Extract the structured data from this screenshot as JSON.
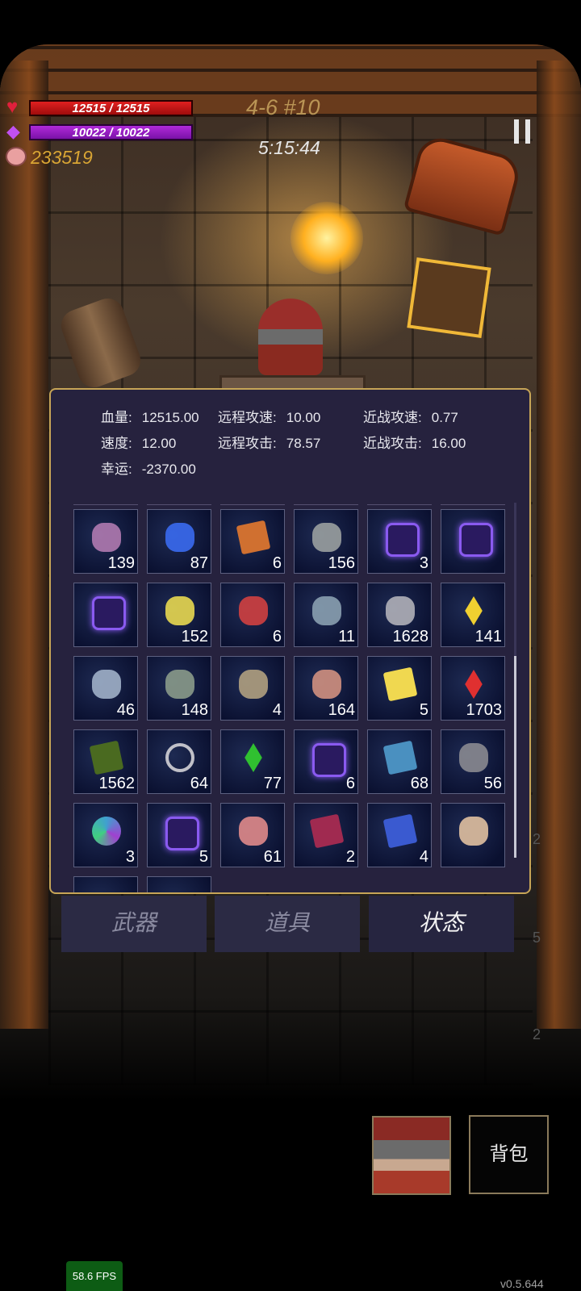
{
  "hud": {
    "hp_text": "12515 / 12515",
    "mp_text": "10022 / 10022",
    "gold": "233519",
    "stage": "4-6 #10",
    "timer": "5:15:44",
    "hp_fraction": 1.0,
    "mp_fraction": 1.0
  },
  "stats": [
    {
      "label": "血量:",
      "value": "12515.00"
    },
    {
      "label": "远程攻速:",
      "value": "10.00"
    },
    {
      "label": "近战攻速:",
      "value": "0.77"
    },
    {
      "label": "速度:",
      "value": "12.00"
    },
    {
      "label": "远程攻击:",
      "value": "78.57"
    },
    {
      "label": "近战攻击:",
      "value": "16.00"
    },
    {
      "label": "幸运:",
      "value": "-2370.00"
    }
  ],
  "inventory": [
    {
      "icon": "boots-icon",
      "count": "139",
      "color": "#b07ab0"
    },
    {
      "icon": "potion-icon",
      "count": "87",
      "color": "#3a6af0"
    },
    {
      "icon": "book-icon",
      "count": "6",
      "color": "#d07030"
    },
    {
      "icon": "flask-icon",
      "count": "156",
      "color": "#9aa0a0"
    },
    {
      "icon": "rune-icon",
      "count": "3",
      "color": "#8a5af0"
    },
    {
      "icon": "rune-icon",
      "count": "",
      "color": "#8a5af0"
    },
    {
      "icon": "rune-icon",
      "count": "",
      "color": "#8a5af0"
    },
    {
      "icon": "star-icon",
      "count": "152",
      "color": "#e8d850"
    },
    {
      "icon": "berries-icon",
      "count": "6",
      "color": "#d04040"
    },
    {
      "icon": "hook-icon",
      "count": "11",
      "color": "#8aa0b0"
    },
    {
      "icon": "ore-icon",
      "count": "1628",
      "color": "#b0b0b8"
    },
    {
      "icon": "crystal-icon",
      "count": "141",
      "color": "#f0d030"
    },
    {
      "icon": "flower-icon",
      "count": "46",
      "color": "#a0b0c8"
    },
    {
      "icon": "squid-icon",
      "count": "148",
      "color": "#8a9a8a"
    },
    {
      "icon": "egg-icon",
      "count": "4",
      "color": "#b0a080"
    },
    {
      "icon": "mushroom-icon",
      "count": "164",
      "color": "#d09080"
    },
    {
      "icon": "card-icon",
      "count": "5",
      "color": "#f0d850"
    },
    {
      "icon": "crystal-icon",
      "count": "1703",
      "color": "#e03030"
    },
    {
      "icon": "book-icon",
      "count": "1562",
      "color": "#4a6a20"
    },
    {
      "icon": "ring-icon",
      "count": "64",
      "color": "#c0c0c8"
    },
    {
      "icon": "crystal-icon",
      "count": "77",
      "color": "#30c030"
    },
    {
      "icon": "rune-icon",
      "count": "6",
      "color": "#8a5af0"
    },
    {
      "icon": "book-icon",
      "count": "68",
      "color": "#4a90c0"
    },
    {
      "icon": "stone-icon",
      "count": "56",
      "color": "#8a8a90"
    },
    {
      "icon": "orb-icon",
      "count": "3",
      "color": "#40a0d0"
    },
    {
      "icon": "rune-icon",
      "count": "5",
      "color": "#8a5af0"
    },
    {
      "icon": "flowers-icon",
      "count": "61",
      "color": "#e08a8a"
    },
    {
      "icon": "book-icon",
      "count": "2",
      "color": "#a02a50"
    },
    {
      "icon": "book-icon",
      "count": "4",
      "color": "#3a5ad0"
    },
    {
      "icon": "skull-icon",
      "count": "",
      "color": "#e0c0a0"
    }
  ],
  "tabs": [
    {
      "label": "武器",
      "active": false
    },
    {
      "label": "道具",
      "active": false
    },
    {
      "label": "状态",
      "active": true
    }
  ],
  "side_counts": [
    "2",
    "5",
    "2"
  ],
  "bag_label": "背包",
  "fps": "58.6 FPS",
  "version": "v0.5.644"
}
